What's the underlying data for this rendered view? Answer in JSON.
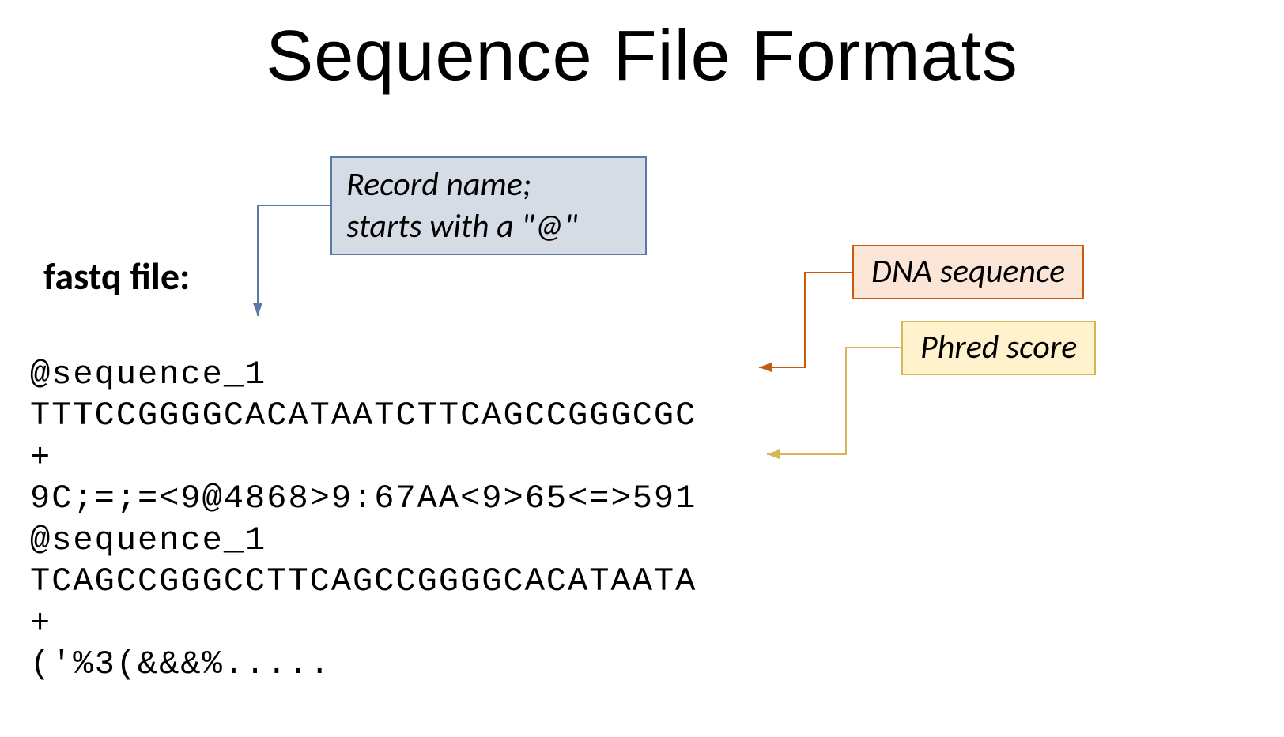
{
  "title": "Sequence File Formats",
  "section_label": "fastq file:",
  "callouts": {
    "record": "Record name;\nstarts with a \"@\"",
    "dna": "DNA sequence",
    "phred": "Phred score"
  },
  "fastq_lines": {
    "l1": "@sequence_1",
    "l2": "TTTCCGGGGCACATAATCTTCAGCCGGGCGC",
    "l3": "+",
    "l4": "9C;=;=<9@4868>9:67AA<9>65<=>591",
    "l5": "@sequence_1",
    "l6": "TCAGCCGGGCCTTCAGCCGGGGCACATAATA",
    "l7": "+",
    "l8": "('%3(&&&%....."
  }
}
